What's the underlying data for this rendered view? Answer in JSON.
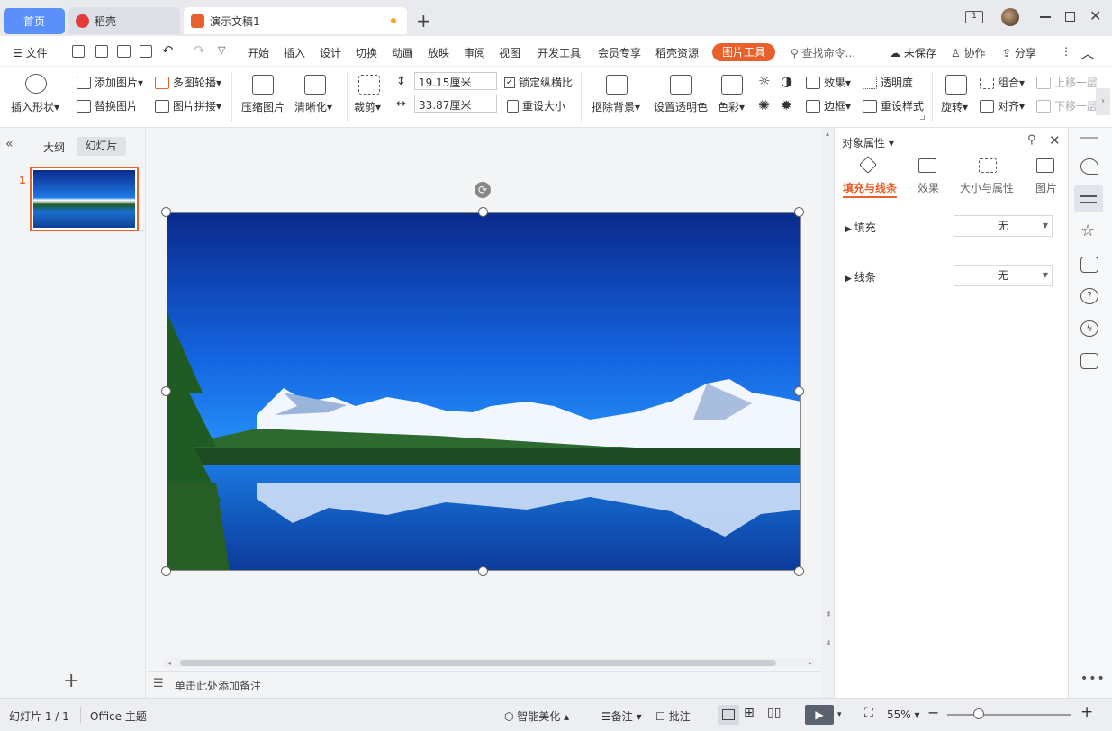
{
  "tabs": {
    "home": "首页",
    "daoke": "稻壳",
    "doc": "演示文稿1"
  },
  "menu": {
    "file": "文件",
    "items": [
      "开始",
      "插入",
      "设计",
      "切换",
      "动画",
      "放映",
      "审阅",
      "视图",
      "开发工具",
      "会员专享",
      "稻壳资源"
    ],
    "active": "图片工具",
    "search": "查找命令...",
    "unsaved": "未保存",
    "collab": "协作",
    "share": "分享"
  },
  "ribbon": {
    "insert_shape": "插入形状",
    "add_picture": "添加图片",
    "replace_picture": "替换图片",
    "multi_carousel": "多图轮播",
    "picture_stitch": "图片拼接",
    "compress": "压缩图片",
    "clarify": "清晰化",
    "crop": "裁剪",
    "height": "19.15厘米",
    "width": "33.87厘米",
    "lock_ratio": "锁定纵横比",
    "reset_size": "重设大小",
    "remove_bg": "抠除背景",
    "set_transparent": "设置透明色",
    "color": "色彩",
    "effects": "效果",
    "transparency": "透明度",
    "border": "边框",
    "reset_style": "重设样式",
    "rotate": "旋转",
    "group": "组合",
    "align": "对齐",
    "bring_forward": "上移一层",
    "send_backward": "下移一层"
  },
  "left": {
    "outline": "大纲",
    "slides": "幻灯片",
    "slide_num": "1"
  },
  "notes": {
    "placeholder": "单击此处添加备注"
  },
  "props": {
    "title": "对象属性",
    "tabs": [
      "填充与线条",
      "效果",
      "大小与属性",
      "图片"
    ],
    "fill_label": "填充",
    "fill_value": "无",
    "line_label": "线条",
    "line_value": "无"
  },
  "status": {
    "slide": "幻灯片 1 / 1",
    "theme": "Office 主题",
    "beautify": "智能美化",
    "notes": "备注",
    "comment": "批注",
    "zoom": "55%"
  },
  "colors": {
    "accent": "#e8602c",
    "tab_home": "#5b8ff9",
    "sky_top": "#0a2a8c",
    "sky_bottom": "#1f8cff"
  }
}
